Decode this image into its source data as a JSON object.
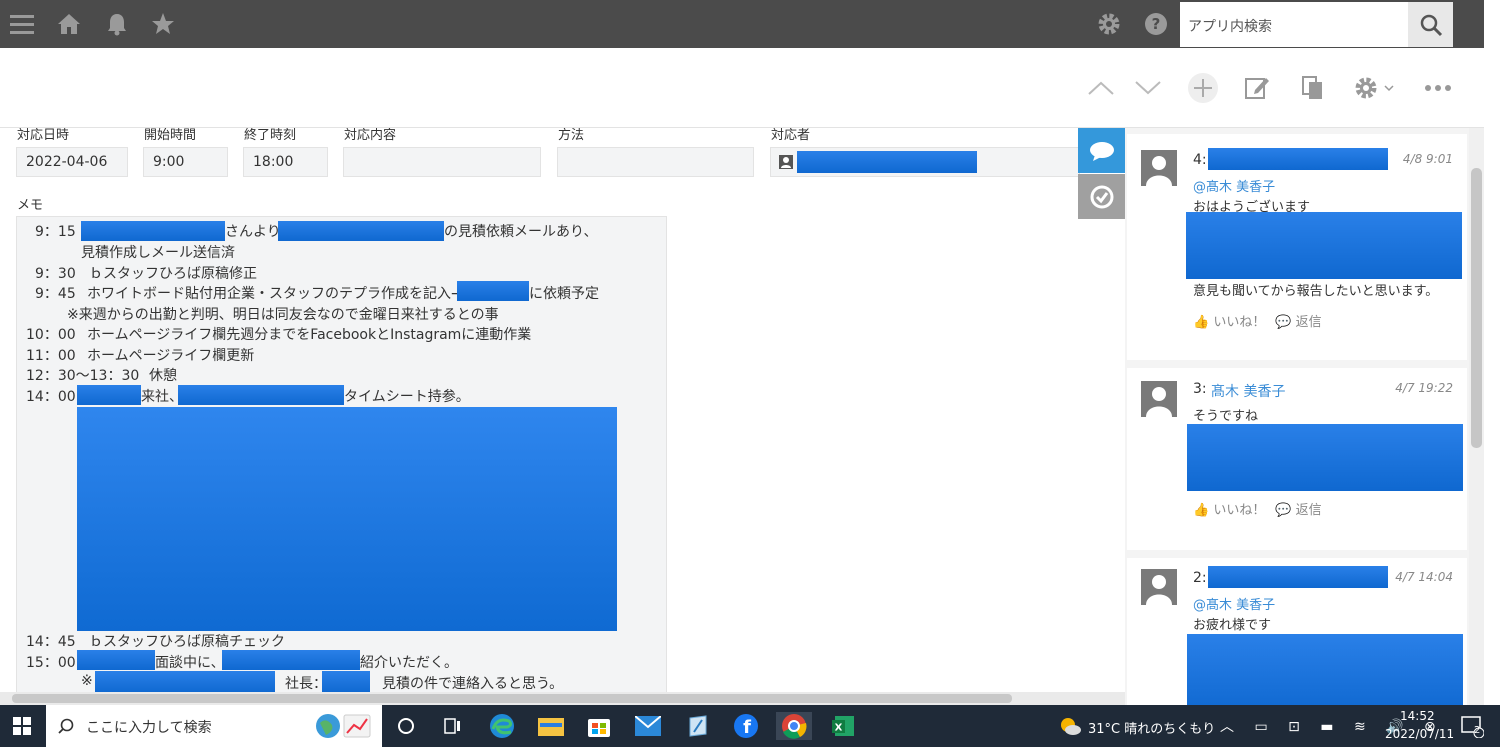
{
  "topbar": {
    "search_placeholder": "アプリ内検索",
    "icons": [
      "menu-icon",
      "home-icon",
      "bell-icon",
      "star-icon",
      "gear-icon",
      "help-icon",
      "search-icon"
    ]
  },
  "fields": {
    "date": {
      "label": "対応日時",
      "value": "2022-04-06"
    },
    "start": {
      "label": "開始時間",
      "value": "9:00"
    },
    "end": {
      "label": "終了時刻",
      "value": "18:00"
    },
    "content": {
      "label": "対応内容",
      "value": ""
    },
    "method": {
      "label": "方法",
      "value": ""
    },
    "staff": {
      "label": "対応者",
      "value": ""
    }
  },
  "memo": {
    "label": "メモ",
    "lines": [
      {
        "time": "9：15",
        "text1": "さんより",
        "text2": "の見積依頼メールあり、"
      },
      {
        "time": "",
        "text1": "見積作成しメール送信済"
      },
      {
        "time": "9：30",
        "text1": "ｂスタッフひろば原稿修正"
      },
      {
        "time": "9：45",
        "text1": "ホワイトボード貼付用企業・スタッフのテプラ作成を記入→",
        "text2": "に依頼予定"
      },
      {
        "time": "",
        "text1": "※来週からの出勤と判明、明日は同友会なので金曜日来社するとの事"
      },
      {
        "time": "10：00",
        "text1": "ホームページライフ欄先週分までをFacebookとInstagramに連動作業"
      },
      {
        "time": "11：00",
        "text1": "ホームページライフ欄更新"
      },
      {
        "time": "12：30～13：30",
        "text1": "休憩"
      },
      {
        "time": "14：00",
        "text1": "来社、",
        "text2": "タイムシート持参。"
      },
      {
        "time": "14：45",
        "text1": "ｂスタッフひろば原稿チェック"
      },
      {
        "time": "15：00",
        "text1": "面談中に、",
        "text2": "紹介いただく。"
      },
      {
        "time": "",
        "text1": "※",
        "text2": "社長：",
        "text3": "見積の件で連絡入ると思う。"
      }
    ]
  },
  "comments": [
    {
      "num": "4:",
      "date": "4/8 9:01",
      "mention": "@髙木 美香子",
      "text": "おはようございます",
      "text2": "意見も聞いてから報告したいと思います。",
      "like": "いいね！",
      "reply": "返信"
    },
    {
      "num": "3:",
      "author": "髙木 美香子",
      "date": "4/7 19:22",
      "text": "そうですね",
      "like": "いいね！",
      "reply": "返信"
    },
    {
      "num": "2:",
      "date": "4/7 14:04",
      "mention": "@髙木 美香子",
      "text": "お疲れ様です"
    }
  ],
  "taskbar": {
    "search_placeholder": "ここに入力して検索",
    "weather": "31°C  晴れのちくもり",
    "time": "14:52",
    "date": "2022/07/11",
    "notification_count": "2"
  }
}
